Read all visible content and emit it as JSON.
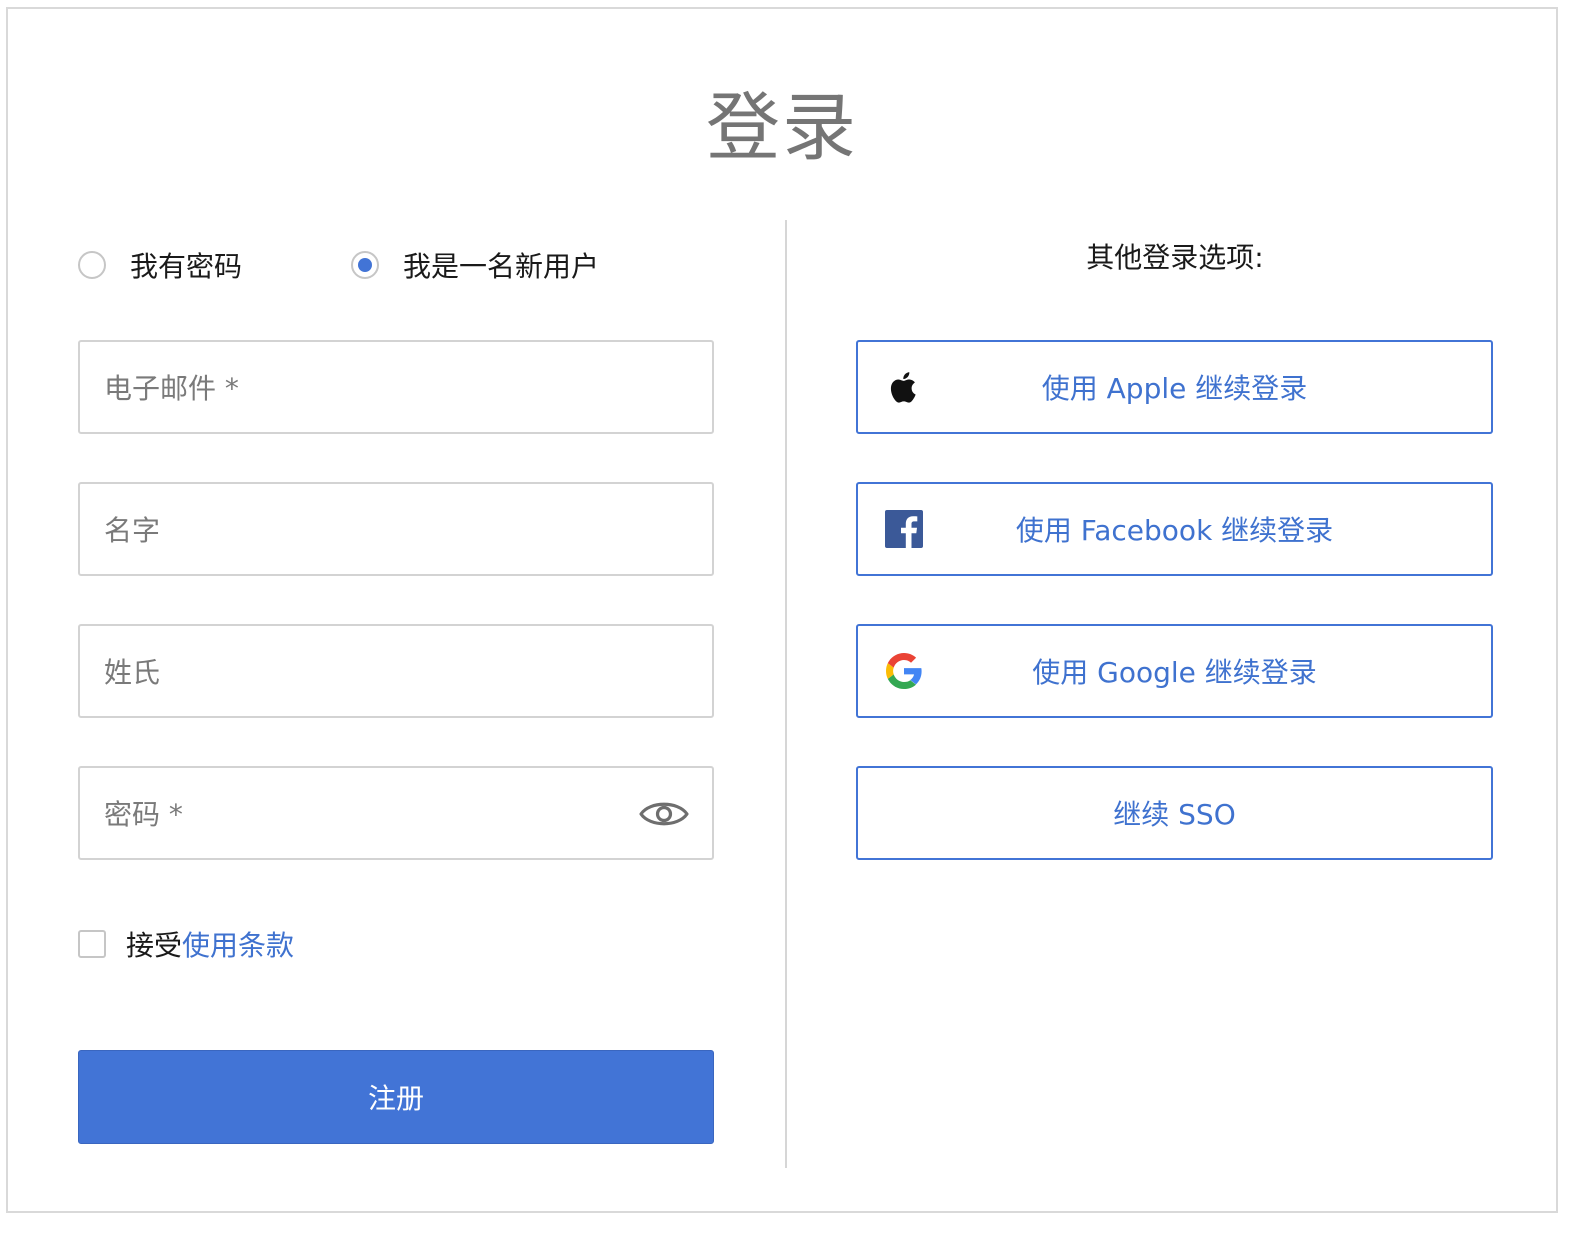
{
  "page_title": "登录",
  "mode_options": [
    {
      "label": "我有密码",
      "checked": false
    },
    {
      "label": "我是一名新用户",
      "checked": true
    }
  ],
  "fields": {
    "email": {
      "placeholder": "电子邮件 *",
      "value": ""
    },
    "first_name": {
      "placeholder": "名字",
      "value": ""
    },
    "last_name": {
      "placeholder": "姓氏",
      "value": ""
    },
    "password": {
      "placeholder": "密码 *",
      "value": ""
    }
  },
  "terms": {
    "prefix": "接受",
    "link": "使用条款",
    "checked": false
  },
  "submit_label": "注册",
  "other_options": {
    "title": "其他登录选项:",
    "buttons": [
      {
        "label": "使用 Apple 继续登录",
        "icon": "apple-icon"
      },
      {
        "label": "使用 Facebook 继续登录",
        "icon": "facebook-icon"
      },
      {
        "label": "使用 Google 继续登录",
        "icon": "google-icon"
      },
      {
        "label": "继续 SSO",
        "icon": ""
      }
    ]
  },
  "colors": {
    "accent": "#4274d6",
    "link": "#3f72cf",
    "title": "#757575",
    "border": "#d3d3d3"
  }
}
